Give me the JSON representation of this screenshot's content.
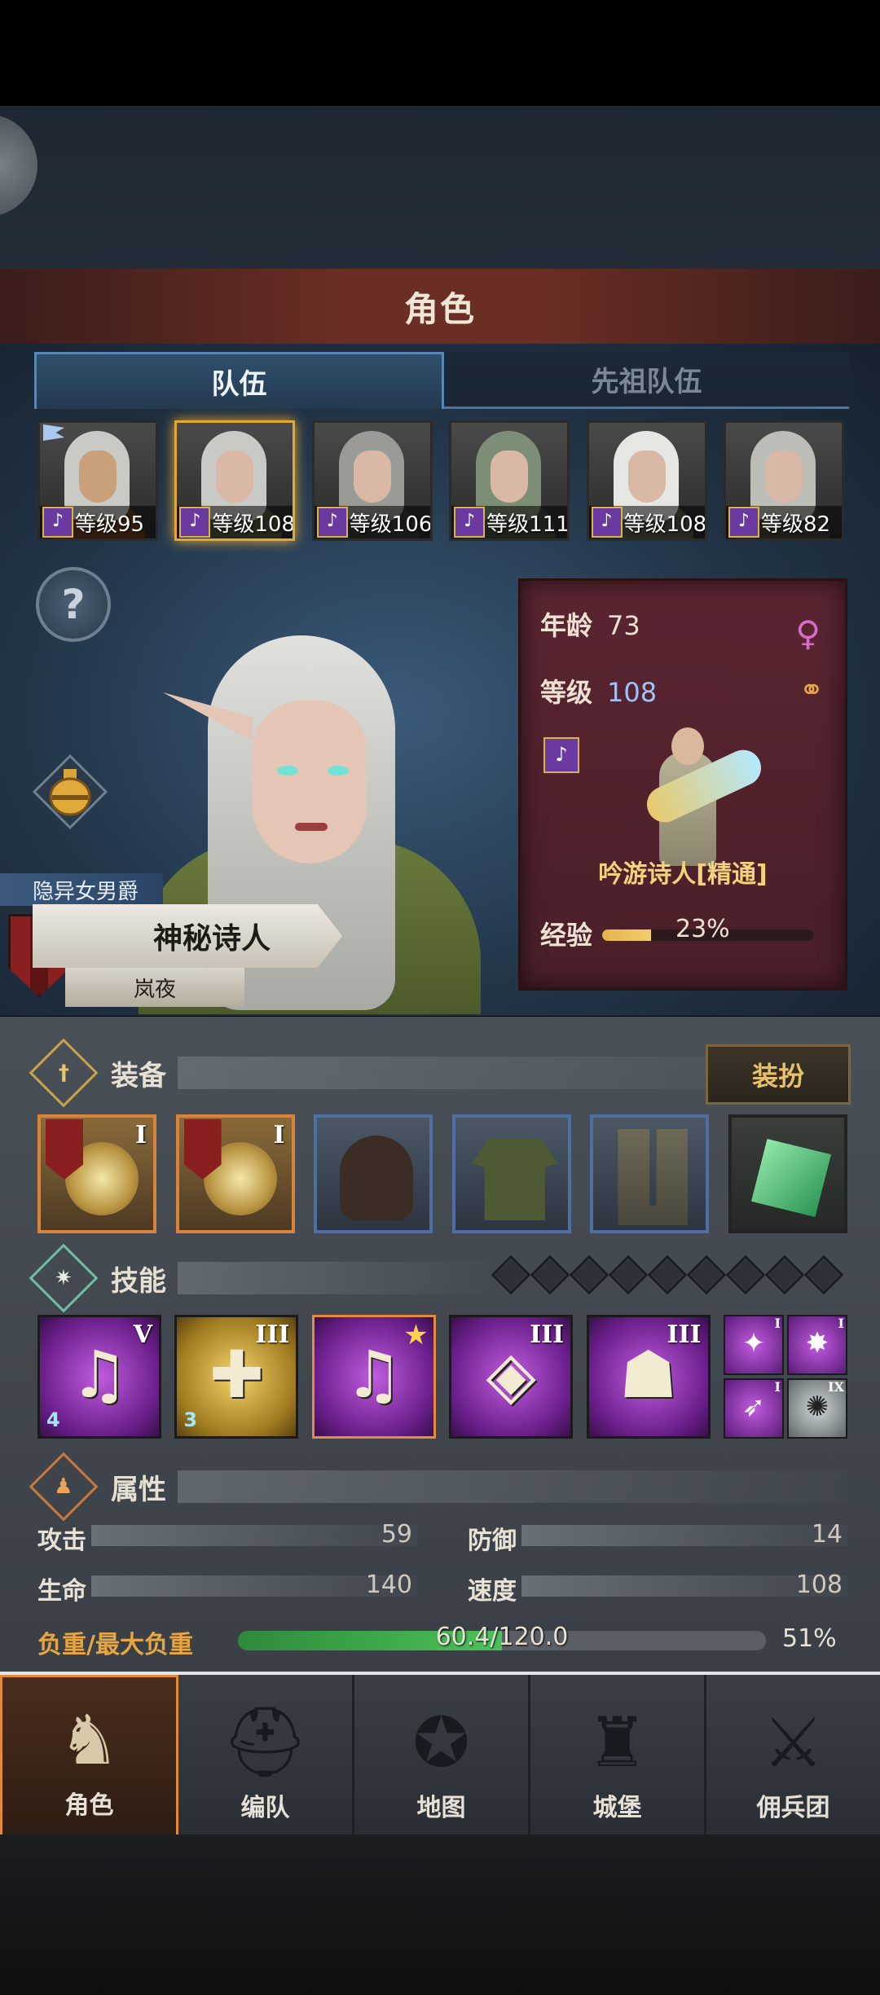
{
  "header": {
    "title": "角色"
  },
  "tabs": [
    {
      "label": "队伍",
      "active": true
    },
    {
      "label": "先祖队伍",
      "active": false
    }
  ],
  "roster": [
    {
      "level_text": "等级95",
      "selected": false,
      "flag": true
    },
    {
      "level_text": "等级108",
      "selected": true,
      "flag": false
    },
    {
      "level_text": "等级106",
      "selected": false,
      "flag": false
    },
    {
      "level_text": "等级111",
      "selected": false,
      "flag": false
    },
    {
      "level_text": "等级108",
      "selected": false,
      "flag": false
    },
    {
      "level_text": "等级82",
      "selected": false,
      "flag": false
    }
  ],
  "character": {
    "title": "隐异女男爵",
    "name": "神秘诗人",
    "subname": "岚夜"
  },
  "info": {
    "age_label": "年龄",
    "age_value": "73",
    "level_label": "等级",
    "level_value": "108",
    "class_name": "吟游诗人[精通]",
    "exp_label": "经验",
    "exp_percent_text": "23%",
    "exp_fraction": 0.23,
    "gender_icon": "female-icon",
    "ring_icon": "rings-icon"
  },
  "equipment": {
    "title": "装备",
    "dress_button": "装扮",
    "slots": [
      {
        "name": "instrument-slot-1",
        "roman": "I",
        "frame": "orange"
      },
      {
        "name": "instrument-slot-2",
        "roman": "I",
        "frame": "orange"
      },
      {
        "name": "hood-slot",
        "roman": "",
        "frame": "blue"
      },
      {
        "name": "tunic-slot",
        "roman": "",
        "frame": "blue"
      },
      {
        "name": "boots-slot",
        "roman": "",
        "frame": "blue"
      },
      {
        "name": "emerald-slot",
        "roman": "",
        "frame": "plain"
      }
    ]
  },
  "skills": {
    "title": "技能",
    "items": [
      {
        "glyph": "♫",
        "roman": "V",
        "sub": "4",
        "style": "purple"
      },
      {
        "glyph": "✚",
        "roman": "III",
        "sub": "3",
        "style": "gold"
      },
      {
        "glyph": "♫",
        "roman": "",
        "sub": "",
        "style": "purple",
        "star": "★"
      },
      {
        "glyph": "◈",
        "roman": "III",
        "sub": "",
        "style": "purple"
      },
      {
        "glyph": "☗",
        "roman": "III",
        "sub": "",
        "style": "purple"
      }
    ],
    "mini": [
      {
        "glyph": "✦",
        "roman": "I",
        "style": "purple"
      },
      {
        "glyph": "✸",
        "roman": "I",
        "style": "purple"
      },
      {
        "glyph": "➶",
        "roman": "I",
        "style": "purple"
      },
      {
        "glyph": "✺",
        "roman": "IX",
        "style": "grey"
      }
    ]
  },
  "attributes": {
    "title": "属性",
    "attack_label": "攻击",
    "attack_value": "59",
    "defense_label": "防御",
    "defense_value": "14",
    "hp_label": "生命",
    "hp_value": "140",
    "speed_label": "速度",
    "speed_value": "108",
    "load_label": "负重/最大负重",
    "load_text": "60.4/120.0",
    "load_percent_text": "51%",
    "load_fraction": 0.5
  },
  "nav": [
    {
      "label": "角色",
      "icon": "knight-icon",
      "active": true
    },
    {
      "label": "编队",
      "icon": "helmet-icon",
      "active": false
    },
    {
      "label": "地图",
      "icon": "compass-map-icon",
      "active": false
    },
    {
      "label": "城堡",
      "icon": "castle-icon",
      "active": false
    },
    {
      "label": "佣兵团",
      "icon": "mercenary-banner-icon",
      "active": false
    }
  ]
}
